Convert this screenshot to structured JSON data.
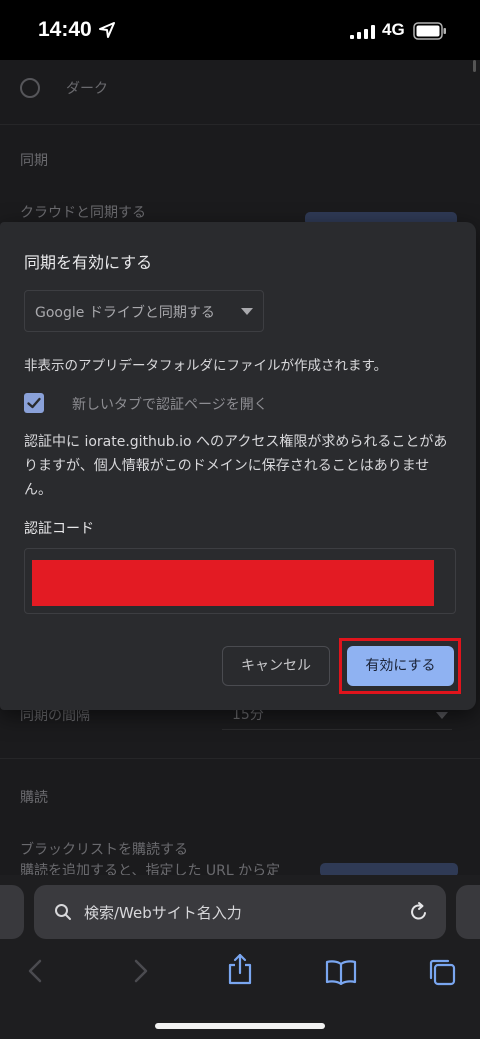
{
  "status_bar": {
    "time": "14:40",
    "network": "4G"
  },
  "background": {
    "theme_dark_label": "ダーク",
    "sync_section": "同期",
    "cloud_sync_label": "クラウドと同期する",
    "sync_interval_label": "同期の間隔",
    "sync_interval_value": "15分",
    "subscription_section": "購読",
    "blacklist_label": "ブラックリストを購読する",
    "blacklist_desc": "購読を追加すると、指定した URL から定"
  },
  "dialog": {
    "title": "同期を有効にする",
    "dropdown_value": "Google ドライブと同期する",
    "info": "非表示のアプリデータフォルダにファイルが作成されます。",
    "checkbox_label": "新しいタブで認証ページを開く",
    "checkbox_checked": true,
    "notice": "認証中に iorate.github.io へのアクセス権限が求められることがありますが、個人情報がこのドメインに保存されることはありません。",
    "code_label": "認証コード",
    "cancel_label": "キャンセル",
    "enable_label": "有効にする"
  },
  "toolbar": {
    "address_placeholder": "検索/Webサイト名入力"
  },
  "colors": {
    "accent": "#8fb2f2",
    "highlight": "#e0141c",
    "dialog_bg": "#2a2b2e"
  }
}
